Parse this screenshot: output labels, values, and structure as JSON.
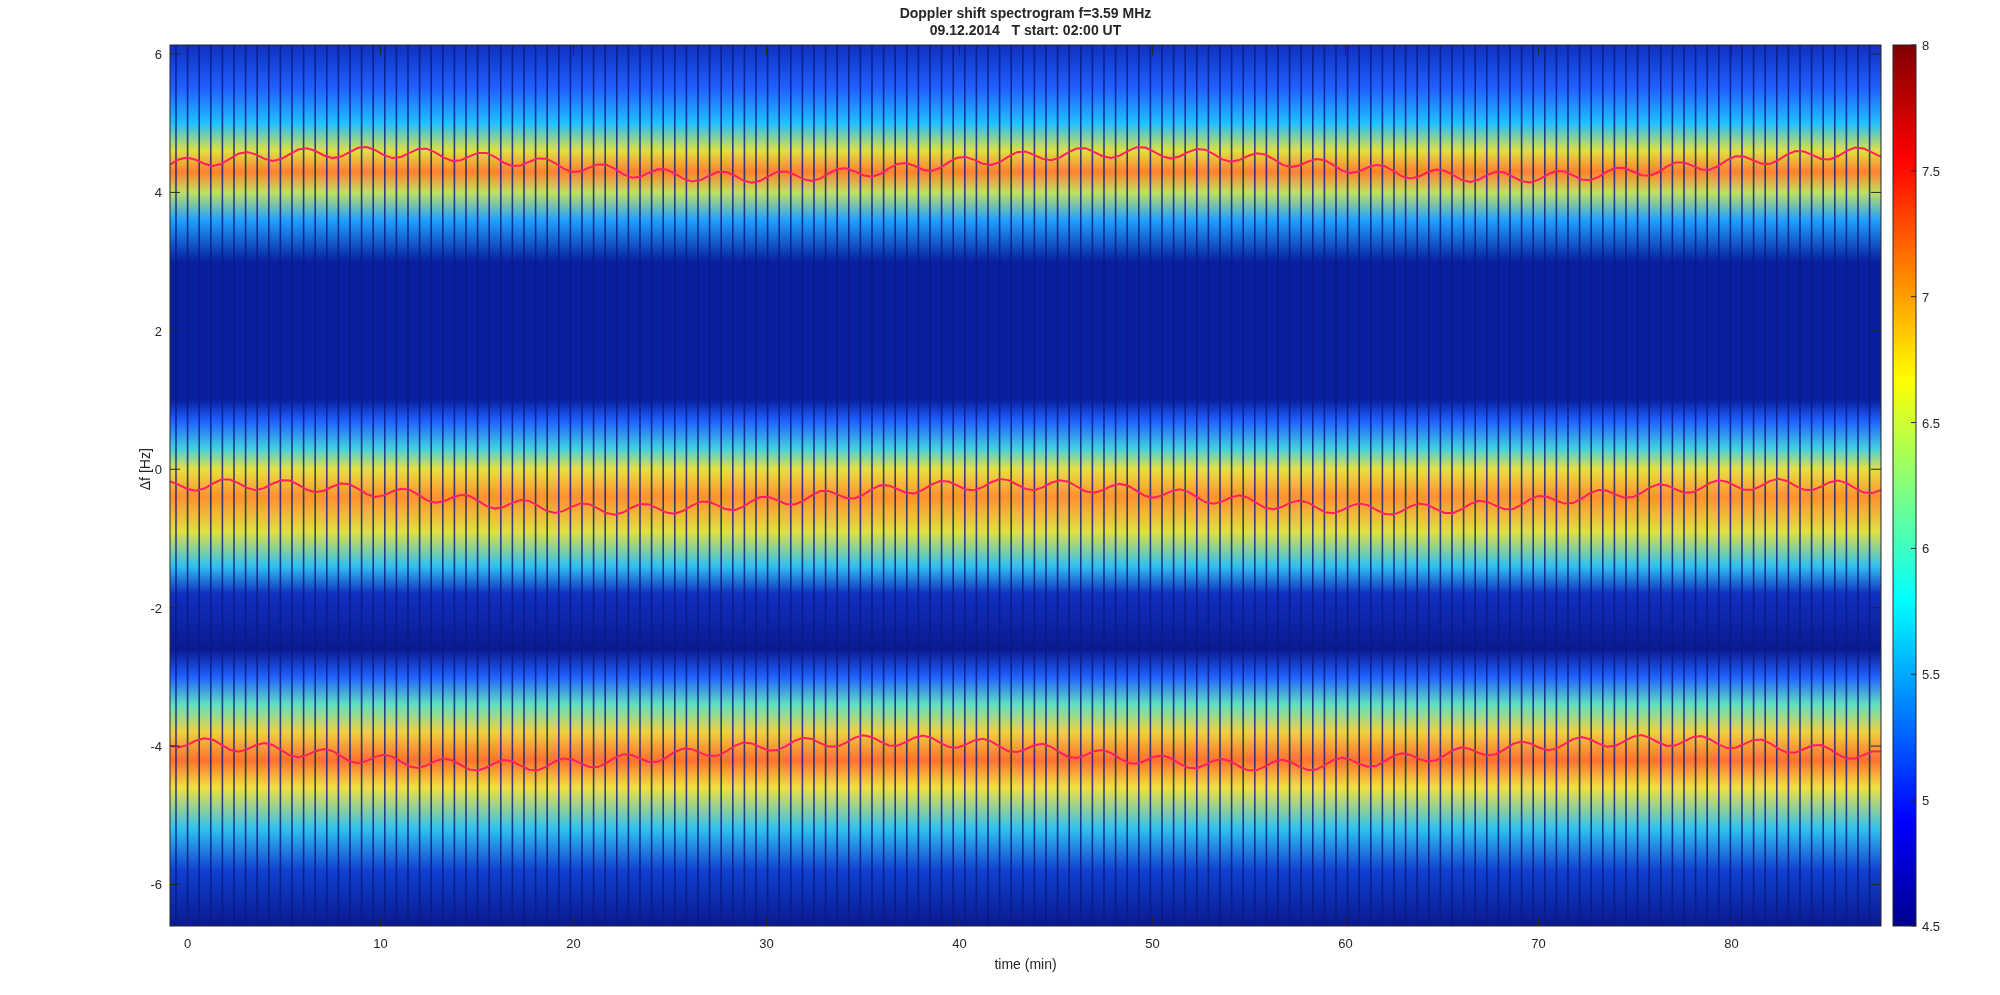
{
  "figure": {
    "title_lines": [
      "Doppler shift spectrogram f=3.59 MHz",
      "09.12.2014   T start: 02:00 UT"
    ],
    "axes": {
      "xlabel": "time (min)",
      "ylabel": "Δf [Hz]",
      "xticks": [
        "0",
        "10",
        "20",
        "30",
        "40",
        "50",
        "60",
        "70",
        "80"
      ],
      "yticks": [
        "6",
        "4",
        "2",
        "0",
        "-2",
        "-4",
        "-6"
      ]
    },
    "colorbar": {
      "ticks": [
        "8",
        "7.5",
        "7",
        "6.5",
        "6",
        "5.5",
        "5",
        "4.5"
      ]
    }
  }
}
